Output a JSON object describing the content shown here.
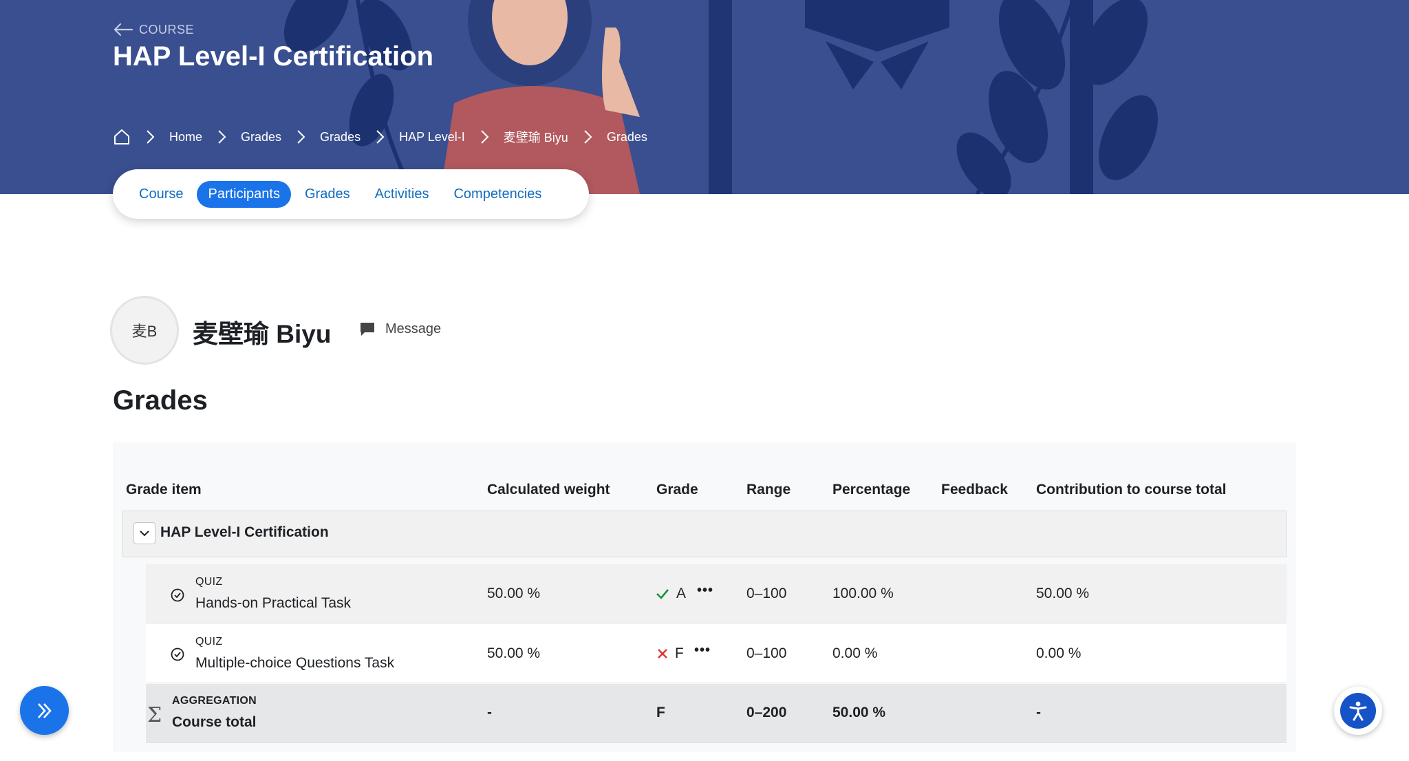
{
  "colors": {
    "banner": "#3a4f8f",
    "accent": "#1a73e8",
    "link": "#0f6cbf",
    "check": "#1a8f3c",
    "cross": "#d9383a"
  },
  "header": {
    "back_label": "COURSE",
    "course_title": "HAP Level-I Certification",
    "breadcrumb": [
      "Home",
      "Grades",
      "Grades",
      "HAP Level-I",
      "麦壁瑜 Biyu",
      "Grades"
    ]
  },
  "tabs": [
    {
      "label": "Course",
      "active": false
    },
    {
      "label": "Participants",
      "active": true
    },
    {
      "label": "Grades",
      "active": false
    },
    {
      "label": "Activities",
      "active": false
    },
    {
      "label": "Competencies",
      "active": false
    }
  ],
  "user": {
    "initials": "麦B",
    "name": "麦壁瑜 Biyu",
    "message_label": "Message"
  },
  "page_heading": "Grades",
  "table": {
    "columns": [
      "Grade item",
      "Calculated weight",
      "Grade",
      "Range",
      "Percentage",
      "Feedback",
      "Contribution to course total"
    ],
    "category": "HAP Level-I Certification",
    "rows": [
      {
        "type": "QUIZ",
        "name": "Hands-on Practical Task",
        "weight": "50.00 %",
        "grade": "A",
        "status": "pass",
        "range": "0–100",
        "percentage": "100.00 %",
        "feedback": "",
        "contribution": "50.00 %"
      },
      {
        "type": "QUIZ",
        "name": "Multiple-choice Questions Task",
        "weight": "50.00 %",
        "grade": "F",
        "status": "fail",
        "range": "0–100",
        "percentage": "0.00 %",
        "feedback": "",
        "contribution": "0.00 %"
      }
    ],
    "total": {
      "type": "AGGREGATION",
      "name": "Course total",
      "weight": "-",
      "grade": "F",
      "range": "0–200",
      "percentage": "50.00 %",
      "feedback": "",
      "contribution": "-"
    }
  },
  "icons": {
    "back": "arrow-left-icon",
    "home": "home-icon",
    "separator": "chevron-right-icon",
    "message": "chat-bubble-icon",
    "collapse": "chevron-down-icon",
    "quiz": "check-circle-icon",
    "total": "sigma-icon",
    "pass": "check-icon",
    "fail": "cross-icon",
    "actions": "ellipsis-icon",
    "drawer": "double-chevron-right-icon",
    "accessibility": "accessibility-icon"
  }
}
